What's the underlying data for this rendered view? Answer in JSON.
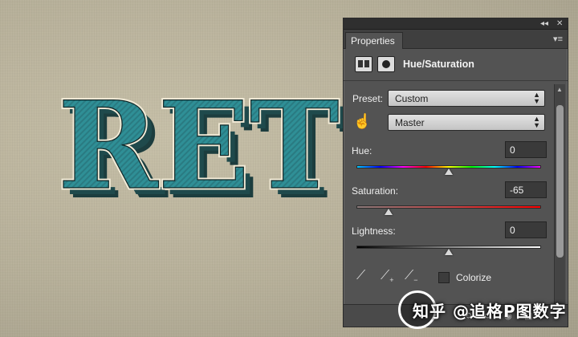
{
  "artwork": {
    "text": "RET",
    "face_color": "#2f8f96",
    "shadow_color": "#1c3d3e",
    "outline_color": "#f3ecd8"
  },
  "panel": {
    "tab_label": "Properties",
    "collapse_glyph": "◂◂",
    "close_glyph": "✕",
    "menu_glyph": "▾≡",
    "adjustment_title": "Hue/Saturation",
    "preset_label": "Preset:",
    "preset_value": "Custom",
    "channel_value": "Master",
    "hue_label": "Hue:",
    "hue_value": "0",
    "saturation_label": "Saturation:",
    "saturation_value": "-65",
    "lightness_label": "Lightness:",
    "lightness_value": "0",
    "colorize_label": "Colorize",
    "sliders": {
      "hue": {
        "min": -180,
        "max": 180,
        "value": 0
      },
      "saturation": {
        "min": -100,
        "max": 100,
        "value": -65
      },
      "lightness": {
        "min": -100,
        "max": 100,
        "value": 0
      }
    },
    "icons": {
      "targeted_adjust": "hand-pointer-icon",
      "eyedropper": "eyedropper-icon",
      "eyedropper_add": "eyedropper-add-icon",
      "eyedropper_subtract": "eyedropper-subtract-icon"
    },
    "colors": {
      "panel_bg": "#535353",
      "tab_bar_bg": "#3f3f3f",
      "text": "#efefef"
    }
  },
  "watermark": {
    "text": "知乎 @追格P图数字"
  }
}
